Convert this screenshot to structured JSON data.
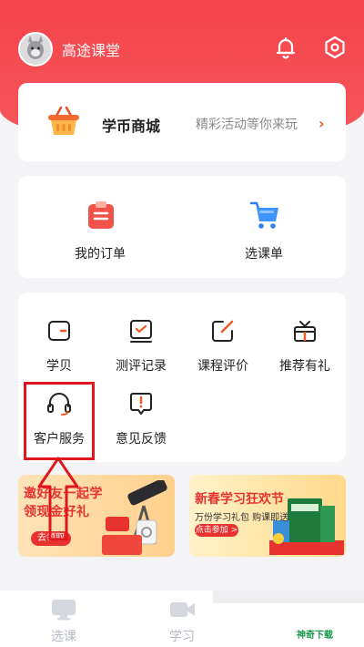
{
  "header": {
    "username": "高途课堂",
    "bg_color": "#f4434a"
  },
  "mall": {
    "title": "学币商城",
    "subtitle": "精彩活动等你来玩",
    "chevron": "›"
  },
  "orders": {
    "items": [
      {
        "label": "我的订单",
        "icon": "clipboard-icon"
      },
      {
        "label": "选课单",
        "icon": "cart-icon"
      }
    ]
  },
  "tools": {
    "items": [
      {
        "label": "学贝",
        "icon": "wallet-icon"
      },
      {
        "label": "测评记录",
        "icon": "evaluation-icon"
      },
      {
        "label": "课程评价",
        "icon": "edit-icon"
      },
      {
        "label": "推荐有礼",
        "icon": "gift-icon"
      },
      {
        "label": "客户服务",
        "icon": "headset-icon"
      },
      {
        "label": "意见反馈",
        "icon": "feedback-icon"
      }
    ]
  },
  "banners": {
    "left": {
      "line1": "邀好友一起学",
      "line2": "领现金好礼",
      "button": "去领取"
    },
    "right": {
      "line1": "新春学习狂欢节",
      "line2": "万份学习礼包 购课即送",
      "button": "点击参加 >"
    }
  },
  "tabbar": {
    "items": [
      {
        "label": "选课",
        "icon": "monitor-icon"
      },
      {
        "label": "学习",
        "icon": "video-icon"
      }
    ]
  },
  "watermark": "神奇下载",
  "colors": {
    "accent": "#f4434a",
    "highlight": "#e0161d",
    "mall_chevron": "#f05a24"
  }
}
